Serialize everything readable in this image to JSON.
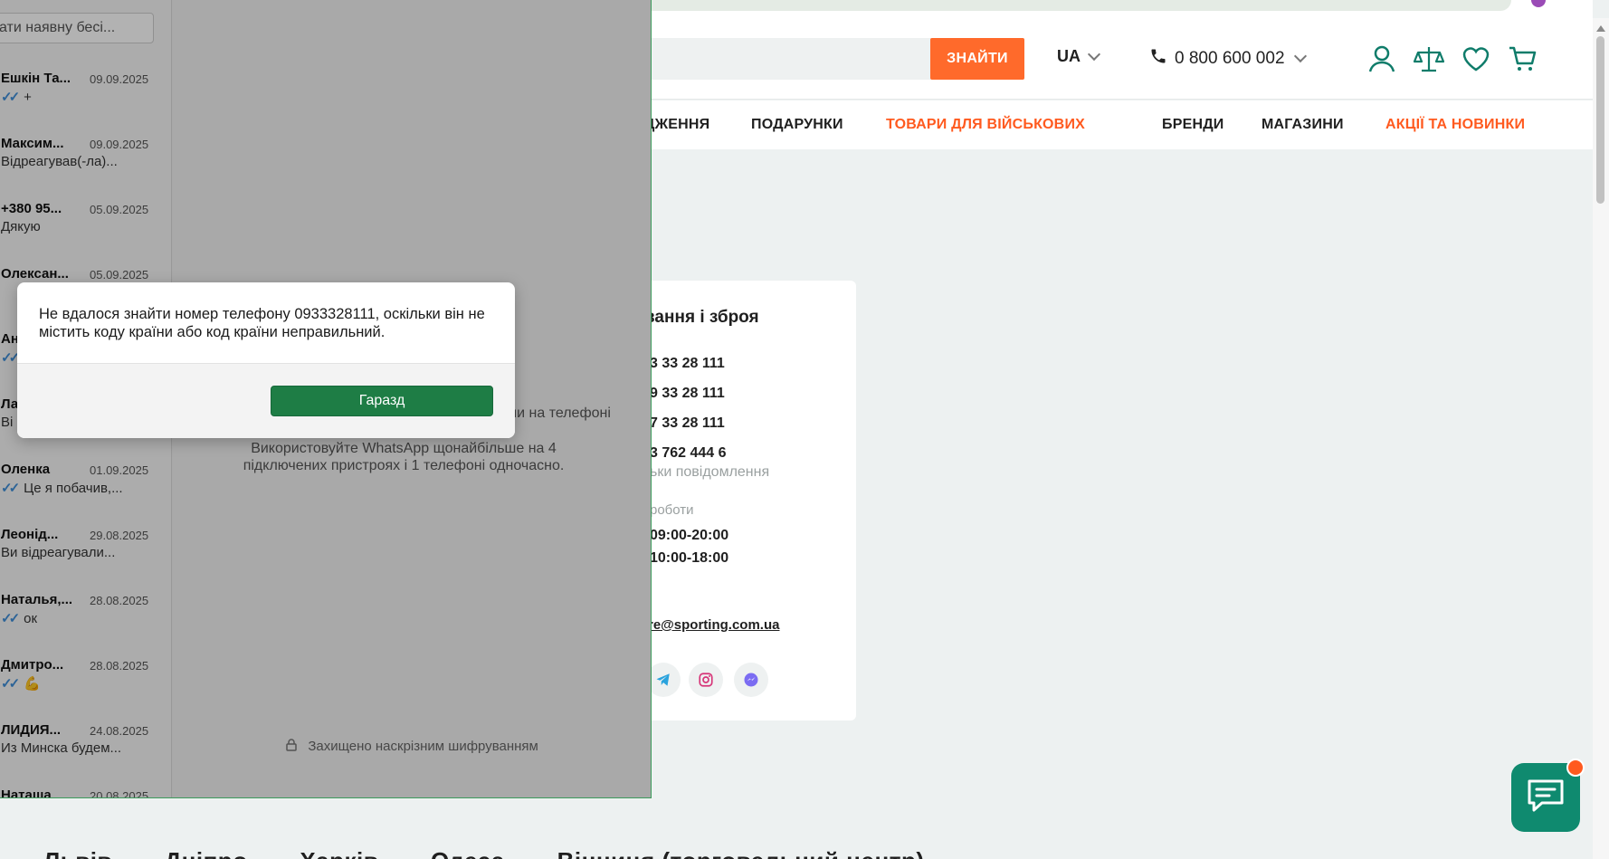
{
  "site": {
    "search_button": "ЗНАЙТИ",
    "language": "UA",
    "phone": "0 800 600 002",
    "nav": [
      "ДЖЕННЯ",
      "ПОДАРУНКИ",
      "ТОВАРИ ДЛЯ ВІЙСЬКОВИХ",
      "БРЕНДИ",
      "МАГАЗИНИ",
      "АКЦІЇ ТА НОВИНКИ"
    ],
    "card": {
      "title": "вання і зброя",
      "phones": [
        "3 33 28 111",
        "9 33 28 111",
        "7 33 28 111",
        "3 762 444 6"
      ],
      "messages_note": "ьки повідомлення",
      "hours_label": "роботи",
      "hours": [
        "09:00-20:00",
        "10:00-18:00"
      ],
      "email": "re@sporting.com.ua"
    },
    "cities": [
      "Львів",
      "Дніпро",
      "Харків",
      "Одеса",
      "Вінниця (торговельний центр)"
    ],
    "accent_color": "#ff6a2b",
    "brand_color": "#0f8a6f"
  },
  "whatsapp": {
    "search_placeholder": "ати наявну бесі...",
    "chats": [
      {
        "name": "Ешкін Та...",
        "date": "09.09.2025",
        "preview": "+",
        "ticks": true
      },
      {
        "name": "Максим...",
        "date": "09.09.2025",
        "preview": "Відреагував(-ла)...",
        "ticks": false
      },
      {
        "name": "+380 95...",
        "date": "05.09.2025",
        "preview": "Дякую",
        "ticks": false
      },
      {
        "name": "Олексан...",
        "date": "05.09.2025",
        "preview": "",
        "ticks": false
      },
      {
        "name": "Ан",
        "date": "",
        "preview": "",
        "ticks": true
      },
      {
        "name": "Ла",
        "date": "",
        "preview": "Ві",
        "ticks": false
      },
      {
        "name": "Оленка",
        "date": "01.09.2025",
        "preview": "Це я побачив,...",
        "ticks": true
      },
      {
        "name": "Леонід...",
        "date": "29.08.2025",
        "preview": "Ви відреагували...",
        "ticks": false
      },
      {
        "name": "Наталья,...",
        "date": "28.08.2025",
        "preview": "ок",
        "ticks": true
      },
      {
        "name": "Дмитро...",
        "date": "28.08.2025",
        "preview": "💪",
        "ticks": true
      },
      {
        "name": "ЛИДИЯ...",
        "date": "24.08.2025",
        "preview": "Из Минска будем...",
        "ticks": false
      },
      {
        "name": "Наташа",
        "date": "20.08.2025",
        "preview": "",
        "ticks": false
      }
    ],
    "info_line1": "коли на телефоні",
    "info_line2": "Використовуйте WhatsApp щонайбільше на 4 підключених пристроях і 1 телефоні одночасно.",
    "encryption": "Захищено наскрізним шифруванням"
  },
  "dialog": {
    "message": "Не вдалося знайти номер телефону 0933328111, оскільки він не містить коду країни або код країни неправильний.",
    "ok_label": "Гаразд",
    "ok_color": "#1e7d45"
  }
}
